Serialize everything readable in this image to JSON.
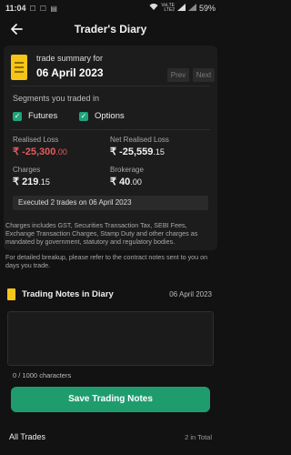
{
  "status_bar": {
    "time": "11:04",
    "left_icons": "☐ ☐ ▤",
    "network_top": "VoLTE",
    "network_bottom": "LTE2",
    "battery": "59%"
  },
  "app_bar": {
    "title": "Trader's Diary"
  },
  "summary": {
    "label": "trade summary for",
    "date": "06 April 2023",
    "prev_label": "Prev",
    "next_label": "Next"
  },
  "segments": {
    "title": "Segments you traded in",
    "items": [
      {
        "label": "Futures",
        "checked": true
      },
      {
        "label": "Options",
        "checked": true
      }
    ]
  },
  "stats": {
    "realised_loss": {
      "label": "Realised Loss",
      "currency": "₹",
      "value": "-25,300",
      "decimal": ".00"
    },
    "net_realised_loss": {
      "label": "Net Realised Loss",
      "currency": "₹",
      "value": "-25,559",
      "decimal": ".15"
    },
    "charges": {
      "label": "Charges",
      "currency": "₹",
      "value": "219",
      "decimal": ".15"
    },
    "brokerage": {
      "label": "Brokerage",
      "currency": "₹",
      "value": "40",
      "decimal": ".00"
    }
  },
  "executed_text": "Executed 2 trades on 06 April 2023",
  "charges_note": "Charges includes GST, Securities Transaction Tax, SEBI Fees, Exchange Transaction Charges, Stamp Duty and other charges as mandated by government, statutory and regulatory bodies.",
  "breakup_note": "For detailed breakup, please refer to the contract notes sent to you on days you trade.",
  "trading_notes": {
    "title": "Trading Notes in Diary",
    "date": "06 April 2023",
    "value": "",
    "char_count": "0 / 1000 characters",
    "save_label": "Save Trading Notes"
  },
  "all_trades": {
    "title": "All Trades",
    "total": "2 in Total"
  },
  "colors": {
    "background": "#121212",
    "card": "#1c1c1c",
    "accent_green": "#1f9c6e",
    "loss_red": "#e35b5b",
    "note_yellow": "#f5c518"
  }
}
